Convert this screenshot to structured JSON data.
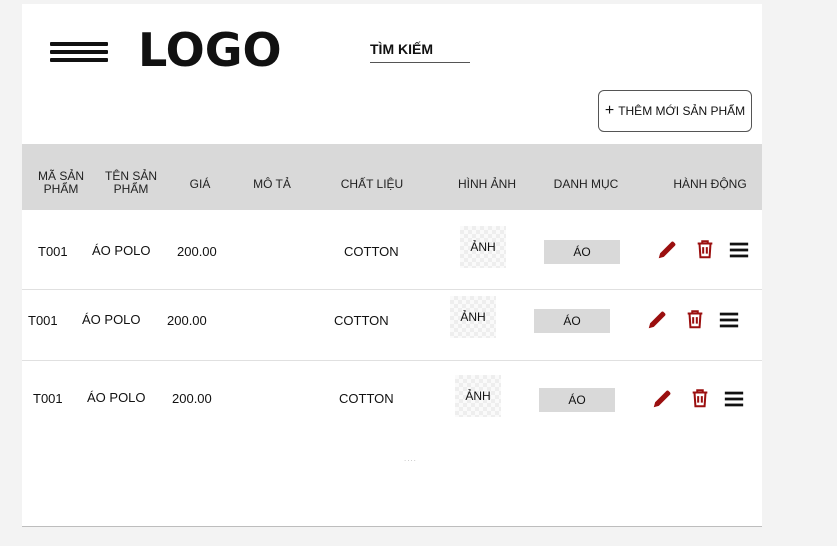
{
  "header": {
    "logo": "LOGO",
    "search_label": "TÌM KIẾM",
    "add_button_label": "THÊM MỚI SẢN PHẨM",
    "add_button_icon": "plus-icon"
  },
  "table": {
    "columns": {
      "code": [
        "MÃ SẢN",
        "PHẨM"
      ],
      "name": [
        "TÊN SẢN",
        "PHẨM"
      ],
      "price": "GIÁ",
      "description": "MÔ TẢ",
      "material": "CHẤT LIỆU",
      "image": "HÌNH ẢNH",
      "category": "DANH MỤC",
      "actions": "HÀNH ĐỘNG"
    },
    "rows": [
      {
        "code": "T001",
        "name": "ÁO POLO",
        "price": "200.00",
        "material": "COTTON",
        "image": "ẢNH",
        "category": "ÁO"
      },
      {
        "code": "T001",
        "name": "ÁO POLO",
        "price": "200.00",
        "material": "COTTON",
        "image": "ẢNH",
        "category": "ÁO"
      },
      {
        "code": "T001",
        "name": "ÁO POLO",
        "price": "200.00",
        "material": "COTTON",
        "image": "ẢNH",
        "category": "ÁO"
      }
    ],
    "action_icons": [
      "pencil-icon",
      "trash-icon",
      "menu-icon"
    ],
    "footer_dots": "...."
  },
  "colors": {
    "accent": "#9b0f0f",
    "header_bg": "#d9d9d9",
    "category_bg": "#d9d9d9"
  }
}
